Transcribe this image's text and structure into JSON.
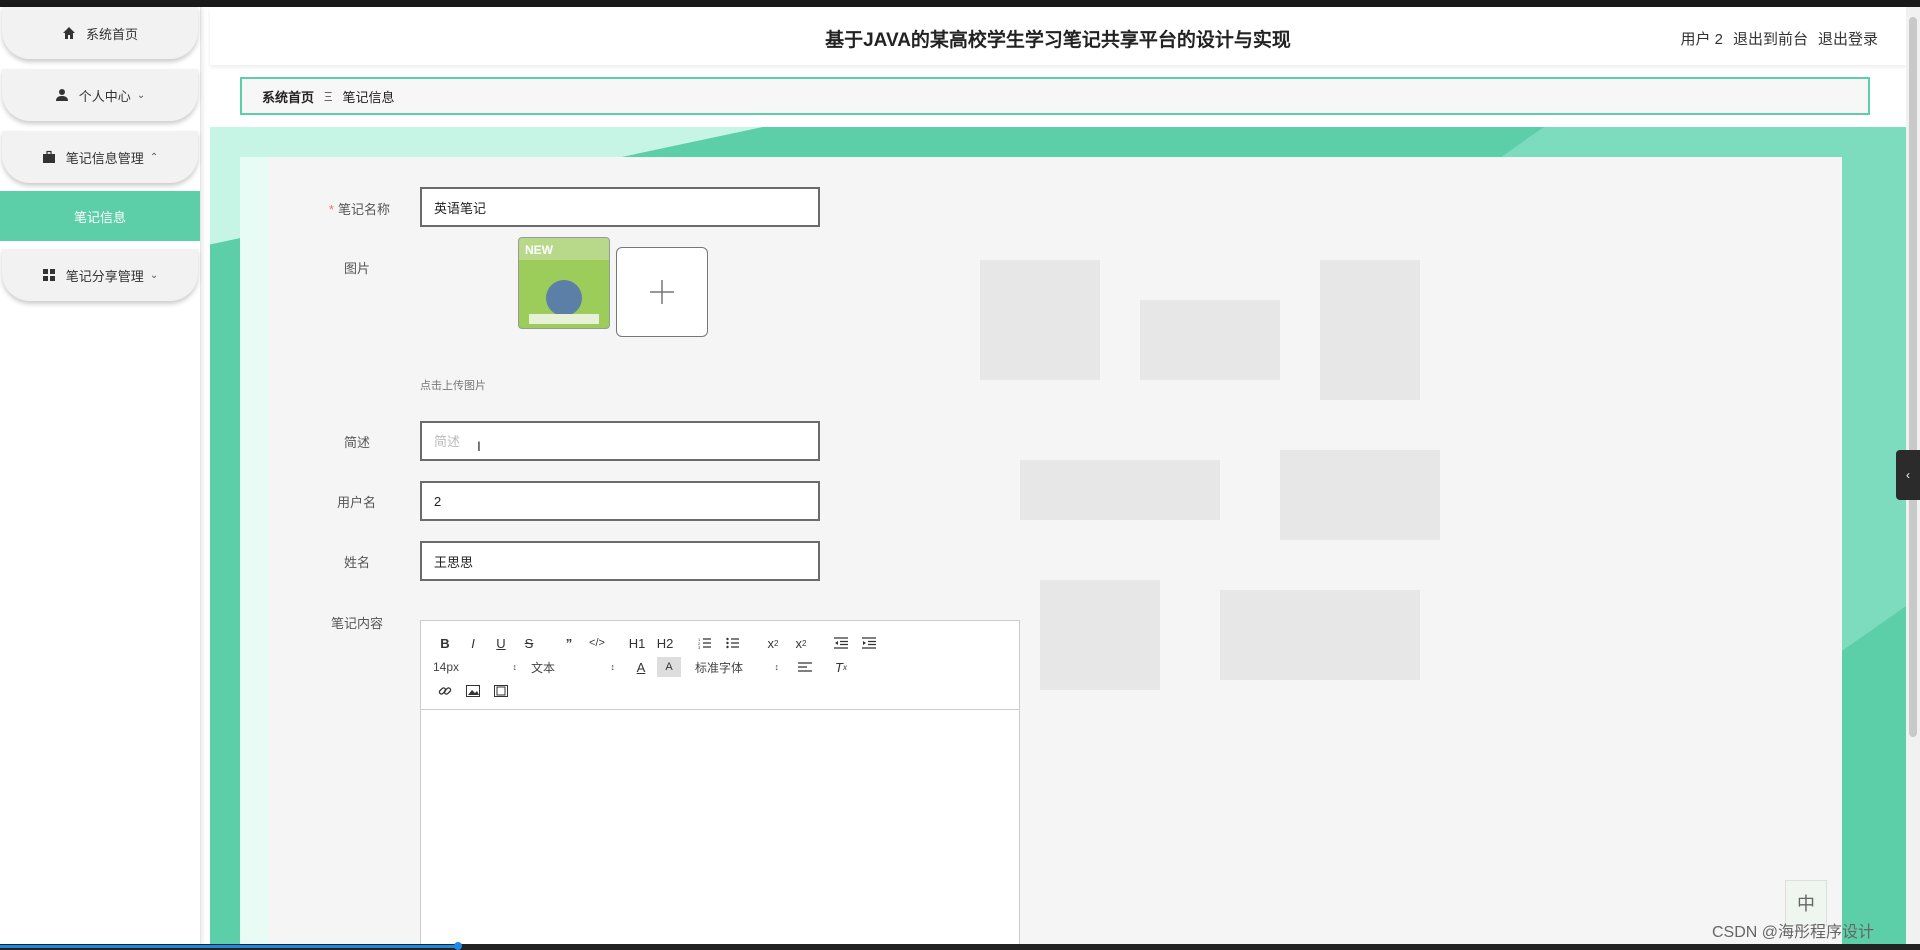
{
  "sidebar": {
    "items": [
      {
        "label": "系统首页",
        "icon": "home-icon",
        "chevron": ""
      },
      {
        "label": "个人中心",
        "icon": "user-icon",
        "chevron": "down"
      },
      {
        "label": "笔记信息管理",
        "icon": "briefcase-icon",
        "chevron": "up"
      },
      {
        "label": "笔记分享管理",
        "icon": "grid-icon",
        "chevron": "down"
      }
    ],
    "active_sub": "笔记信息"
  },
  "header": {
    "title": "基于JAVA的某高校学生学习笔记共享平台的设计与实现",
    "user": "用户 2",
    "to_front": "退出到前台",
    "logout": "退出登录"
  },
  "breadcrumb": {
    "home": "系统首页",
    "separator": "Ξ",
    "current": "笔记信息"
  },
  "form": {
    "name_label": "笔记名称",
    "name_value": "英语笔记",
    "image_label": "图片",
    "upload_hint": "点击上传图片",
    "desc_label": "简述",
    "desc_placeholder": "简述",
    "username_label": "用户名",
    "username_value": "2",
    "realname_label": "姓名",
    "realname_value": "王思思",
    "content_label": "笔记内容"
  },
  "editor": {
    "font_size": "14px",
    "header_select": "文本",
    "font_family": "标准字体",
    "h1": "H1",
    "h2": "H2"
  },
  "ime": {
    "label": "中"
  },
  "watermark": "CSDN @海彤程序设计",
  "colors": {
    "accent": "#5ccfa8",
    "accent_light": "#c6f5e6"
  }
}
